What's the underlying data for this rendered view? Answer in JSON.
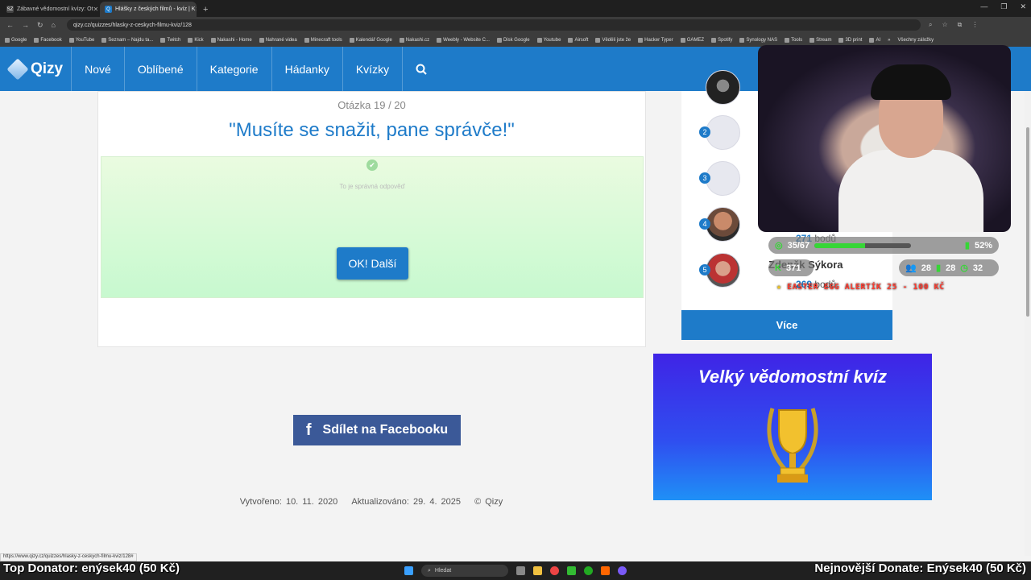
{
  "browser": {
    "tabs": [
      {
        "favicon": "SZ",
        "title": "Zábavné vědomostní kvízy: Ot"
      },
      {
        "favicon": "Q",
        "title": "Hlášky z českých filmů - kvíz | K"
      }
    ],
    "url": "qizy.cz/quizzes/hlasky-z-ceskych-filmu-kviz/128",
    "bookmarks": [
      "Google",
      "Facebook",
      "YouTube",
      "Seznam – Najdu ta...",
      "Twitch",
      "Kick",
      "Nakashi - Home",
      "Nahrané videa",
      "Minecraft tools",
      "Kalendář Google",
      "Nakashi.cz",
      "Weebly - Website C...",
      "Disk Google",
      "Youtube",
      "Airsoft",
      "Věděli jste že",
      "Hacker Typer",
      "GAMEZ",
      "Spotify",
      "Synology NAS",
      "Tools",
      "Stream",
      "3D print",
      "AI"
    ],
    "bookmarks_more": "»",
    "all_bookmarks": "Všechny záložky"
  },
  "site": {
    "logo": "Qizy",
    "nav": [
      "Nové",
      "Oblíbené",
      "Kategorie",
      "Hádanky",
      "Kvízky"
    ],
    "search_icon": "search-icon"
  },
  "quiz": {
    "progress": "Otázka 19 / 20",
    "question": "\"Musíte se snažit, pane správče!\"",
    "result_text": "To je správná odpověď",
    "next_button": "OK! Další"
  },
  "share": {
    "facebook_label": "Sdílet na Facebooku"
  },
  "footer": {
    "created": "Vytvořeno: 10. 11. 2020",
    "updated": "Aktualizováno: 29. 4. 2025",
    "copyright": "© Qizy"
  },
  "leaderboard": {
    "ranks": [
      "2",
      "3",
      "4",
      "5"
    ],
    "visible_name": "Zdeněk Sýkora",
    "points": [
      {
        "value": "271",
        "unit": "bodů"
      },
      {
        "value": "269",
        "unit": "bodů"
      }
    ],
    "more_button": "Více"
  },
  "ad": {
    "title": "Velký vědomostní kvíz"
  },
  "stream_overlay": {
    "progress_text": "35/67",
    "progress_fraction": 0.522,
    "percent": "52%",
    "stat_a": "28",
    "stat_b": "28",
    "stat_c": "32",
    "stat_left": "371",
    "egg": "EASTER EGG ALERTÍK 25 - 100 KČ",
    "top_donator": "Top Donator: enýsek40 (50 Kč)",
    "latest_donate": "Nejnovější Donate: Enýsek40 (50 Kč)"
  },
  "status_url": "https://www.qizy.cz/quizzes/hlasky-z-ceskych-filmu-kviz/128#",
  "taskbar": {
    "search_placeholder": "Hledat"
  }
}
